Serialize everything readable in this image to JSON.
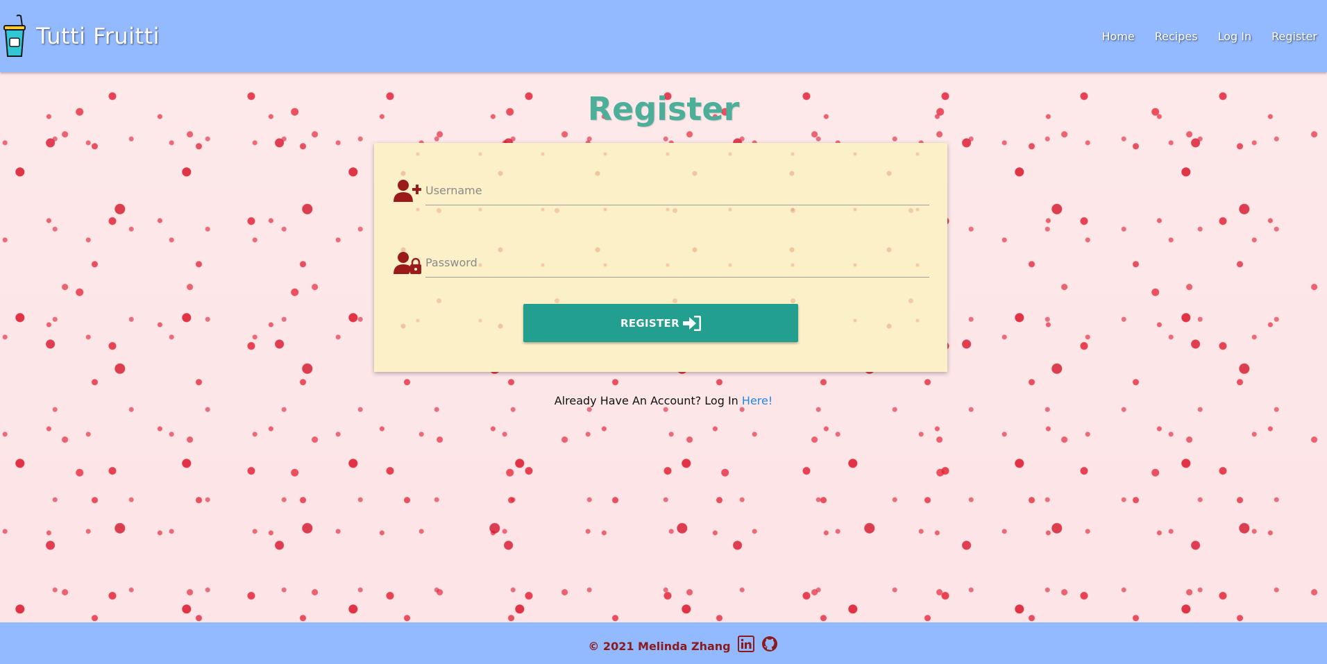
{
  "brand": {
    "name": "Tutti Fruitti",
    "logo_icon": "smoothie-cup-icon"
  },
  "nav": {
    "items": [
      {
        "label": "Home"
      },
      {
        "label": "Recipes"
      },
      {
        "label": "Log In"
      },
      {
        "label": "Register"
      }
    ]
  },
  "main": {
    "title": "Register",
    "form": {
      "username": {
        "icon": "user-plus-icon",
        "placeholder": "Username",
        "value": ""
      },
      "password": {
        "icon": "user-lock-icon",
        "placeholder": "Password",
        "value": ""
      },
      "submit": {
        "label": "REGISTER",
        "icon": "sign-in-icon"
      }
    },
    "login_prompt": {
      "text": "Already Have An Account? Log In ",
      "link_label": "Here!"
    }
  },
  "footer": {
    "copyright": "© 2021 Melinda Zhang",
    "icons": [
      "linkedin-icon",
      "github-icon"
    ]
  },
  "colors": {
    "navbar": "#93b9ff",
    "title": "#4caf99",
    "button": "#239f8f",
    "icon": "#9b1b1b",
    "link": "#1e88e5",
    "card": "#fcf0c9"
  }
}
